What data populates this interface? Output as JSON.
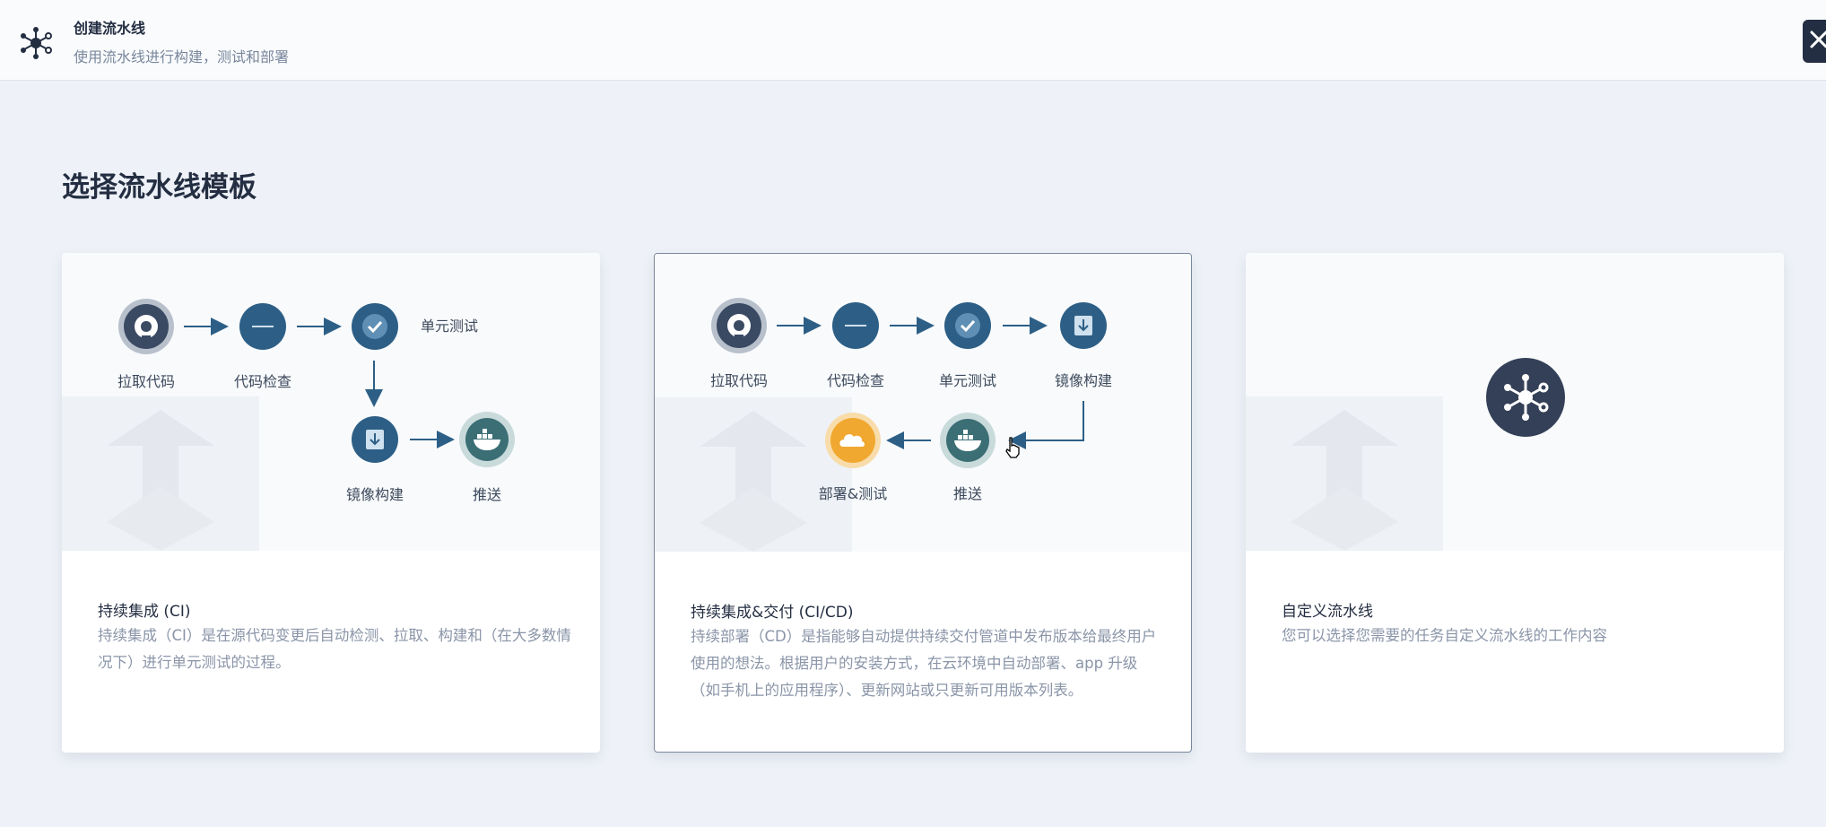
{
  "header": {
    "title": "创建流水线",
    "subtitle": "使用流水线进行构建，测试和部署",
    "icon": "pipeline-icon",
    "close_icon": "close-icon"
  },
  "page": {
    "section_title": "选择流水线模板"
  },
  "cards": [
    {
      "title": "持续集成 (CI)",
      "description": "持续集成（CI）是在源代码变更后自动检测、拉取、构建和（在大多数情况下）进行单元测试的过程。",
      "steps": [
        "拉取代码",
        "代码检查",
        "单元测试",
        "镜像构建",
        "推送"
      ]
    },
    {
      "title": "持续集成&交付 (CI/CD)",
      "description": "持续部署（CD）是指能够自动提供持续交付管道中发布版本给最终用户使用的想法。根据用户的安装方式，在云环境中自动部署、app 升级（如手机上的应用程序）、更新网站或只更新可用版本列表。",
      "steps": [
        "拉取代码",
        "代码检查",
        "单元测试",
        "镜像构建",
        "推送",
        "部署&测试"
      ]
    },
    {
      "title": "自定义流水线",
      "description": "您可以选择您需要的任务自定义流水线的工作内容",
      "icon": "pipeline-icon"
    }
  ],
  "colors": {
    "node": "#2d5f86",
    "github": "#3b4a63",
    "docker": "#3b6e75",
    "deploy": "#f0a830",
    "dark": "#242e42"
  }
}
